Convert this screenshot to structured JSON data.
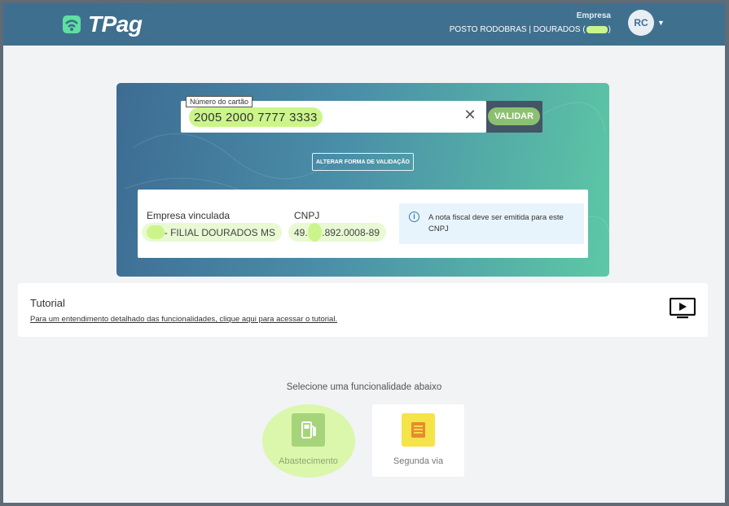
{
  "header": {
    "logo_text": "TPag",
    "company_label": "Empresa",
    "company_value": "POSTO RODOBRAS | DOURADOS (",
    "company_value_end": ")",
    "avatar_initials": "RC",
    "accent_color": "#5de0a0"
  },
  "validation": {
    "card_label": "Número do cartão",
    "card_value": "2005 2000 7777 3333",
    "validate_label": "VALIDAR",
    "alt_button_label": "ALTERAR FORMA DE VALIDAÇÃO"
  },
  "company_info": {
    "linked_company_title": "Empresa vinculada",
    "linked_company_value": "- FILIAL DOURADOS MS",
    "cnpj_title": "CNPJ",
    "cnpj_prefix": "49.",
    "cnpj_suffix": ".892.0008-89",
    "notice_text": "A nota fiscal deve ser emitida para este CNPJ"
  },
  "tutorial": {
    "title": "Tutorial",
    "link_text": "Para um entendimento detalhado das funcionalidades, clique aqui para acessar o tutorial."
  },
  "functions": {
    "prompt": "Selecione uma funcionalidade abaixo",
    "items": [
      {
        "label": "Abastecimento",
        "icon": "fuel-pump-icon",
        "color": "#8cc071"
      },
      {
        "label": "Segunda via",
        "icon": "document-icon",
        "color": "#f5e34a"
      }
    ]
  },
  "highlight_color": "#cbf58a"
}
